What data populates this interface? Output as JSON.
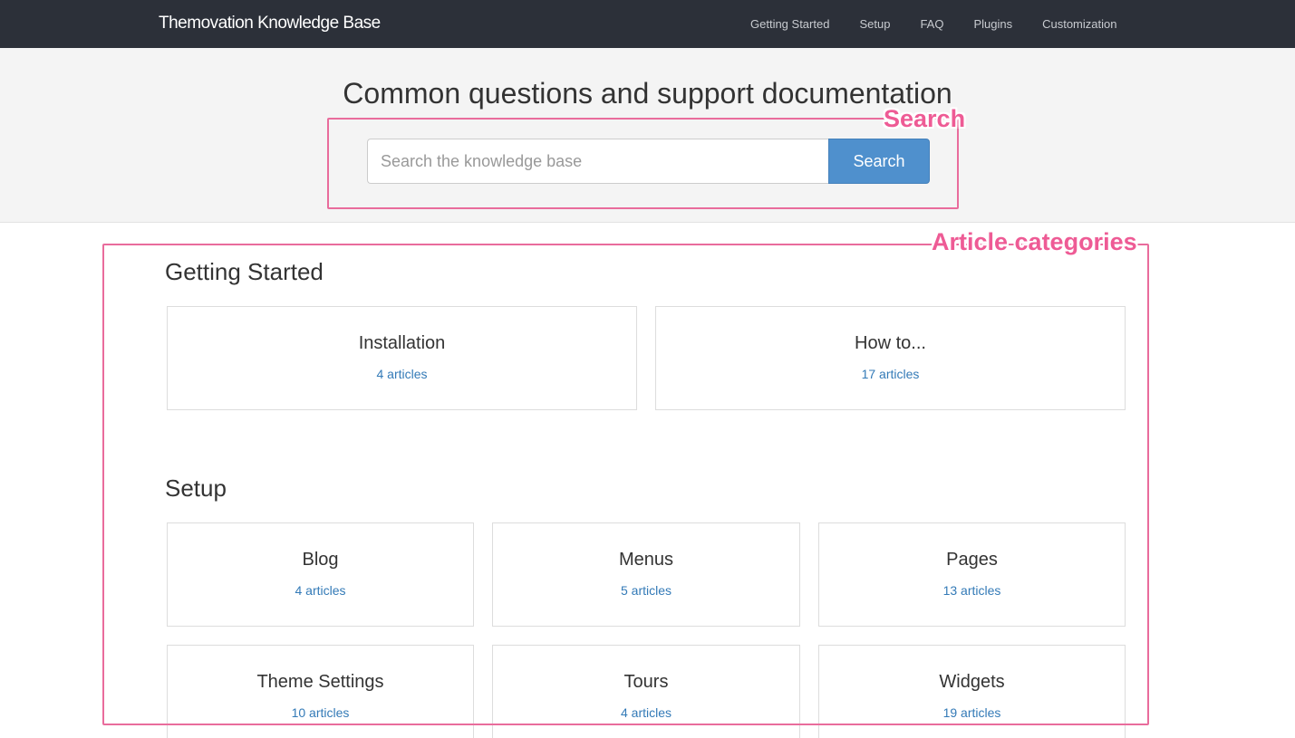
{
  "navbar": {
    "brand": "Themovation Knowledge Base",
    "links": [
      "Getting Started",
      "Setup",
      "FAQ",
      "Plugins",
      "Customization"
    ]
  },
  "hero": {
    "title": "Common questions and support documentation",
    "search_placeholder": "Search the knowledge base",
    "search_button": "Search"
  },
  "annotations": {
    "search": "Search",
    "categories": "Article categories"
  },
  "colors": {
    "navbar_bg": "#2c3039",
    "search_button": "#4f90cd",
    "link": "#337ab7",
    "annotation": "#ee5b95"
  },
  "sections": [
    {
      "title": "Getting Started",
      "cards": [
        {
          "title": "Installation",
          "count": "4 articles"
        },
        {
          "title": "How to...",
          "count": "17 articles"
        }
      ]
    },
    {
      "title": "Setup",
      "cards": [
        {
          "title": "Blog",
          "count": "4 articles"
        },
        {
          "title": "Menus",
          "count": "5 articles"
        },
        {
          "title": "Pages",
          "count": "13 articles"
        },
        {
          "title": "Theme Settings",
          "count": "10 articles"
        },
        {
          "title": "Tours",
          "count": "4 articles"
        },
        {
          "title": "Widgets",
          "count": "19 articles"
        }
      ]
    }
  ]
}
